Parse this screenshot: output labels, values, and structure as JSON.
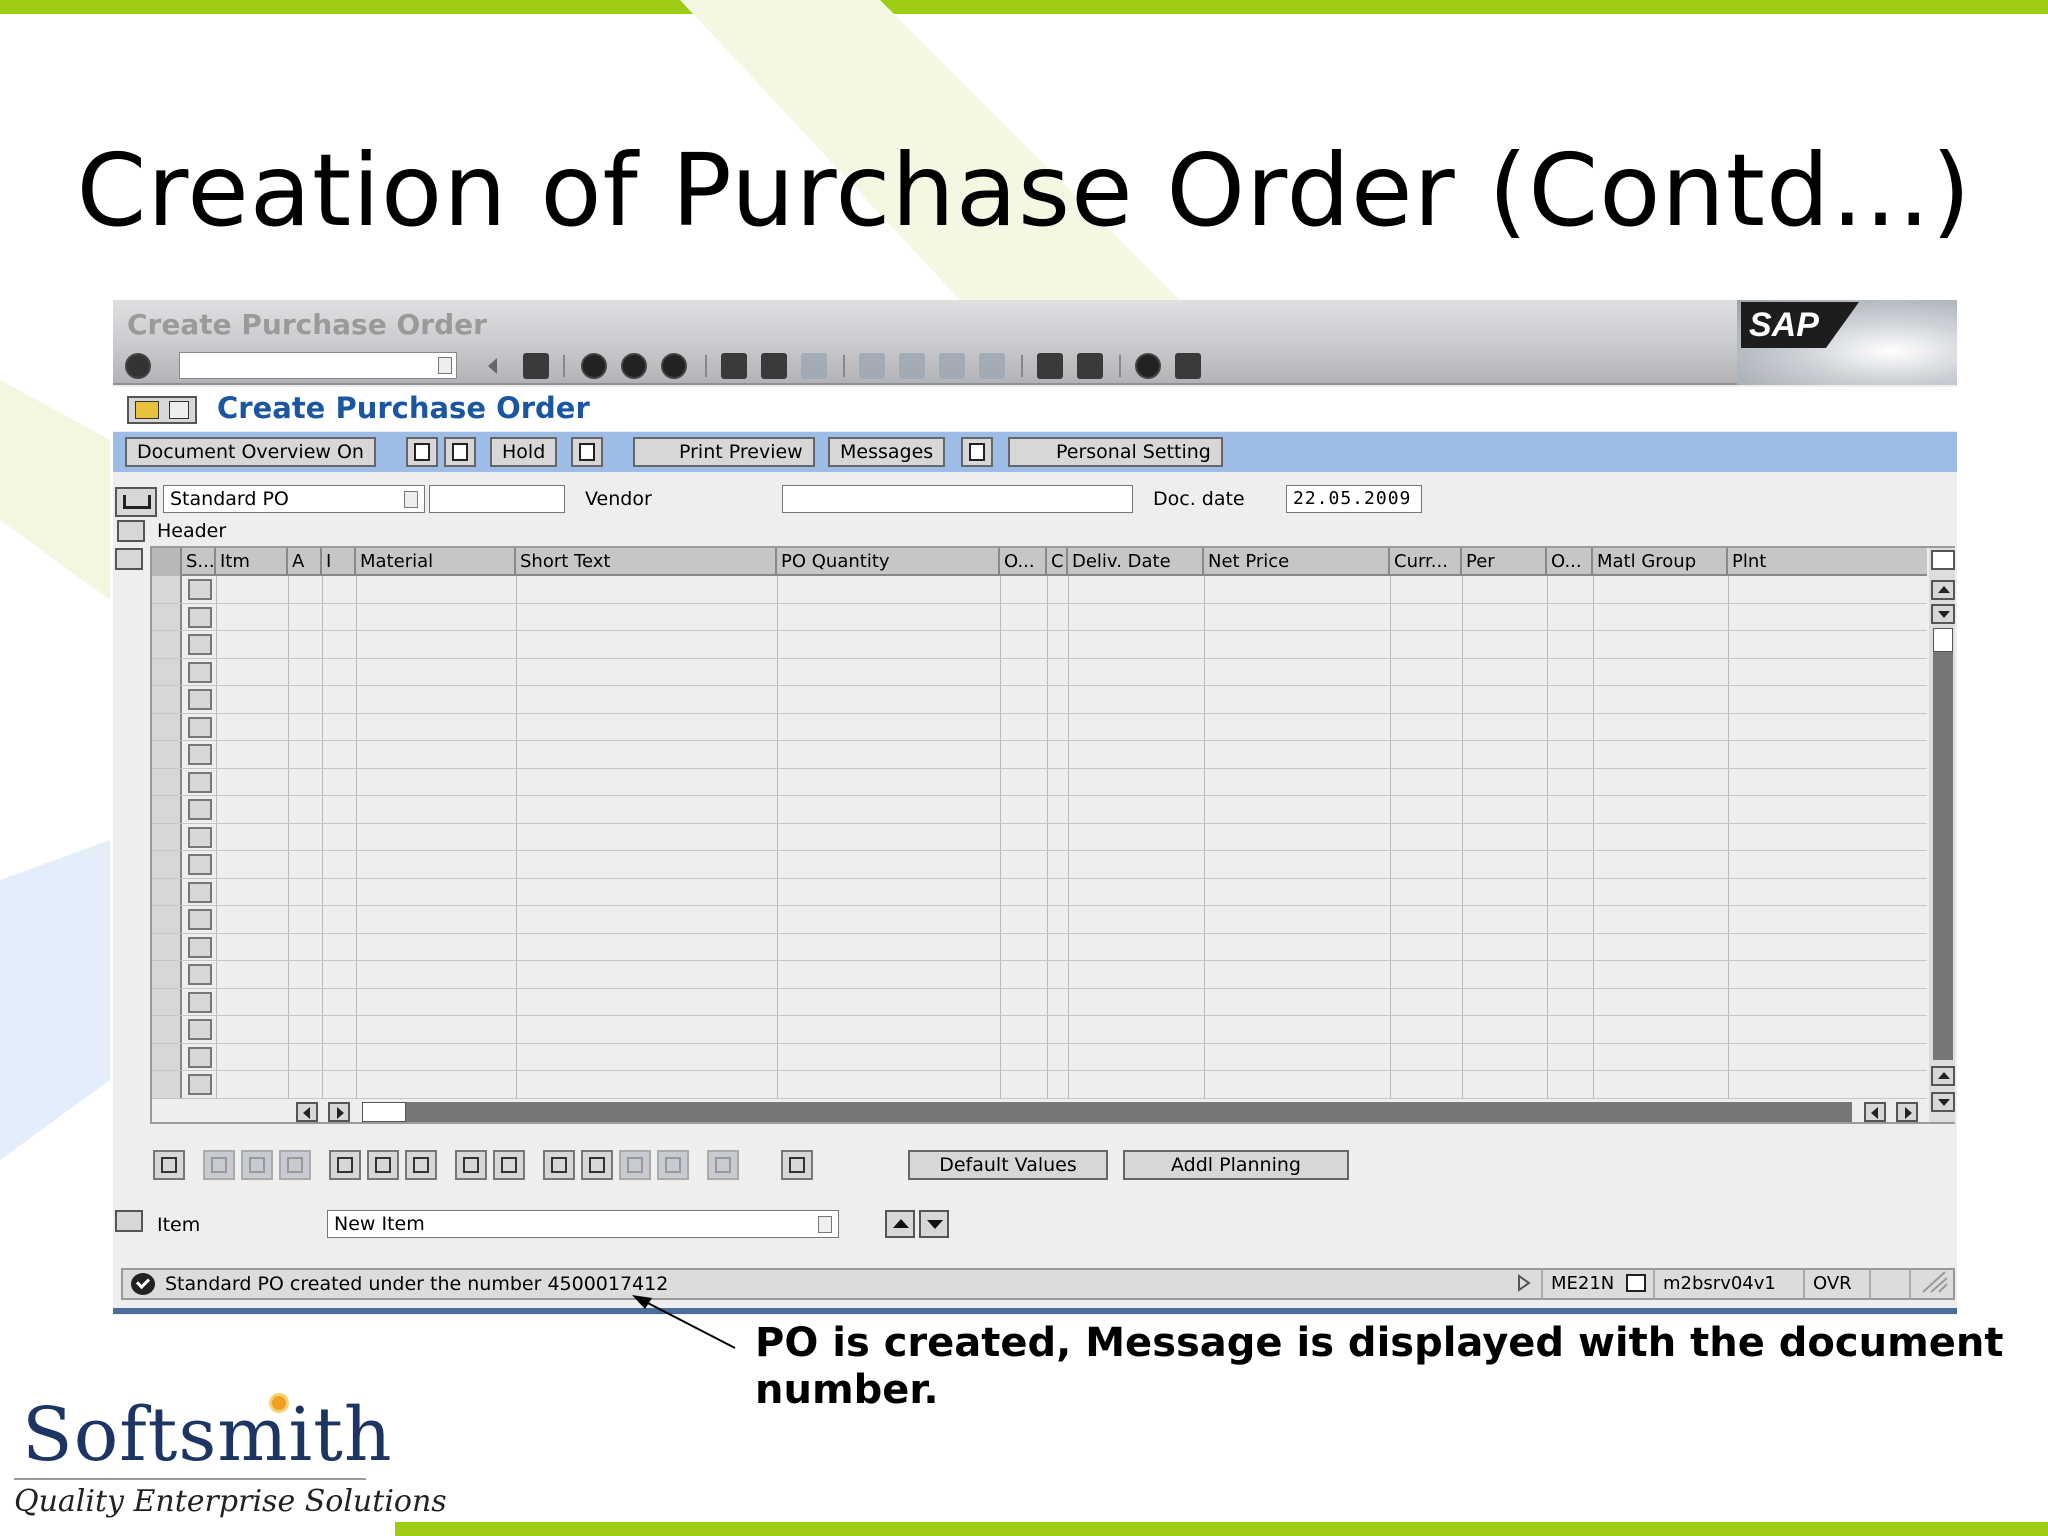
{
  "slide": {
    "title": "Creation of Purchase Order (Contd…)",
    "callout": "PO is created, Message is displayed with the document number.",
    "logo_name": "Softsmith",
    "logo_tagline": "Quality Enterprise Solutions",
    "accent_color": "#9ccc14"
  },
  "window": {
    "title": "Create Purchase Order",
    "logo_text": "SAP",
    "screen_title": "Create Purchase Order",
    "command_field_value": ""
  },
  "app_toolbar": {
    "document_overview": "Document Overview On",
    "hold": "Hold",
    "print_preview": "Print Preview",
    "messages": "Messages",
    "personal_setting": "Personal Setting"
  },
  "header_fields": {
    "doc_type": "Standard PO",
    "doc_type_extra": "",
    "vendor_label": "Vendor",
    "vendor_value": "",
    "doc_date_label": "Doc. date",
    "doc_date_value": "22.05.2009",
    "header_label": "Header"
  },
  "grid": {
    "columns": [
      "S...",
      "Itm",
      "A",
      "I",
      "Material",
      "Short Text",
      "PO Quantity",
      "O...",
      "C",
      "Deliv. Date",
      "Net Price",
      "Curr...",
      "Per",
      "O...",
      "Matl Group",
      "Plnt"
    ],
    "row_count": 19
  },
  "bottom_buttons": {
    "default_values": "Default Values",
    "addl_planning": "Addl Planning"
  },
  "item_row": {
    "label": "Item",
    "value": "New Item"
  },
  "status": {
    "message": "Standard PO created under the number 4500017412",
    "transaction": "ME21N",
    "server": "m2bsrv04v1",
    "mode": "OVR"
  }
}
